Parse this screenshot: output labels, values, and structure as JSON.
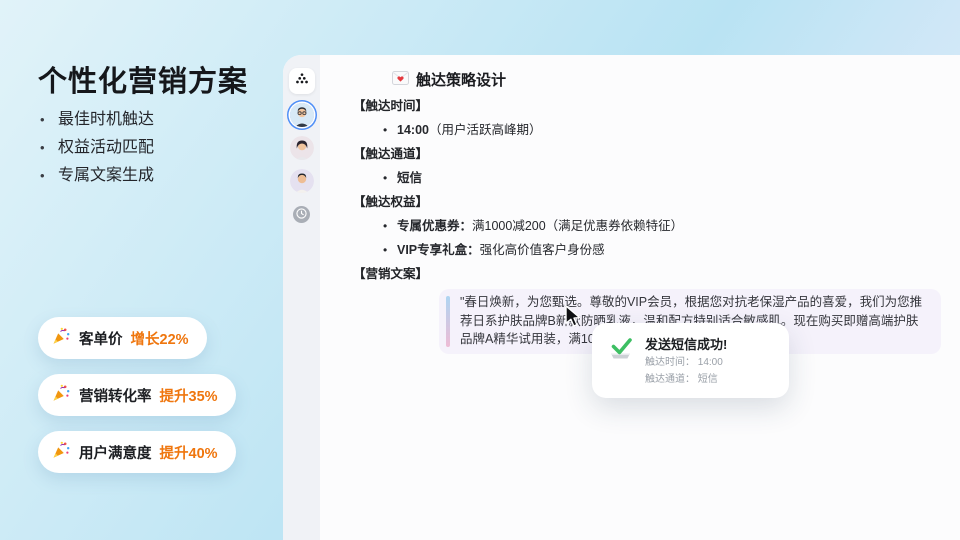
{
  "left_panel": {
    "title": "个性化营销方案",
    "bullets": [
      "最佳时机触达",
      "权益活动匹配",
      "专属文案生成"
    ],
    "stats": [
      {
        "icon": "party-popper-icon",
        "label": "客单价",
        "value": "增长22%"
      },
      {
        "icon": "party-popper-icon",
        "label": "营销转化率",
        "value": "提升35%"
      },
      {
        "icon": "party-popper-icon",
        "label": "用户满意度",
        "value": "提升40%"
      }
    ]
  },
  "rail": {
    "logo_icon": "app-logo-icon",
    "avatars": [
      "agent-avatar-selected",
      "agent-avatar-female",
      "agent-avatar-male"
    ],
    "history_icon": "clock-icon"
  },
  "chat": {
    "header": {
      "icon": "love-letter-icon",
      "title": "触达策略设计"
    },
    "sections": [
      {
        "heading": "【触达时间】",
        "items": [
          {
            "bold": "14:00",
            "text": "（用户活跃高峰期）"
          }
        ]
      },
      {
        "heading": "【触达通道】",
        "items": [
          {
            "bold": "短信",
            "text": ""
          }
        ]
      },
      {
        "heading": "【触达权益】",
        "items": [
          {
            "bold": "专属优惠券：",
            "text": "满1000减200（满足优惠券依赖特征）"
          },
          {
            "bold": "VIP专享礼盒：",
            "text": "强化高价值客户身份感"
          }
        ]
      },
      {
        "heading": "【营销文案】",
        "items": []
      }
    ],
    "quote": "\"春日焕新，为您甄选。尊敬的VIP会员，根据您对抗老保湿产品的喜爱，我们为您推荐日系护肤品牌B新款防晒乳液，温和配方特别适合敏感肌。现在购买即赠高端护肤品牌A精华试用装，满1000再减200。\""
  },
  "toast": {
    "icon": "success-check-icon",
    "title": "发送短信成功!",
    "lines": [
      "触达时间： 14:00",
      "触达通道： 短信"
    ]
  },
  "colors": {
    "accent_orange": "#ef760e",
    "success_green": "#3dbf63",
    "avatar_ring_blue": "#4f8ff7",
    "quote_bg": "#f5f2fb",
    "quote_accent_top": "#aed5f2",
    "quote_accent_bottom": "#eebcd5",
    "panel_gradient_start": "#e1f3f9",
    "panel_gradient_mid": "#b9e3f3",
    "panel_gradient_end": "#e5f0fb"
  }
}
